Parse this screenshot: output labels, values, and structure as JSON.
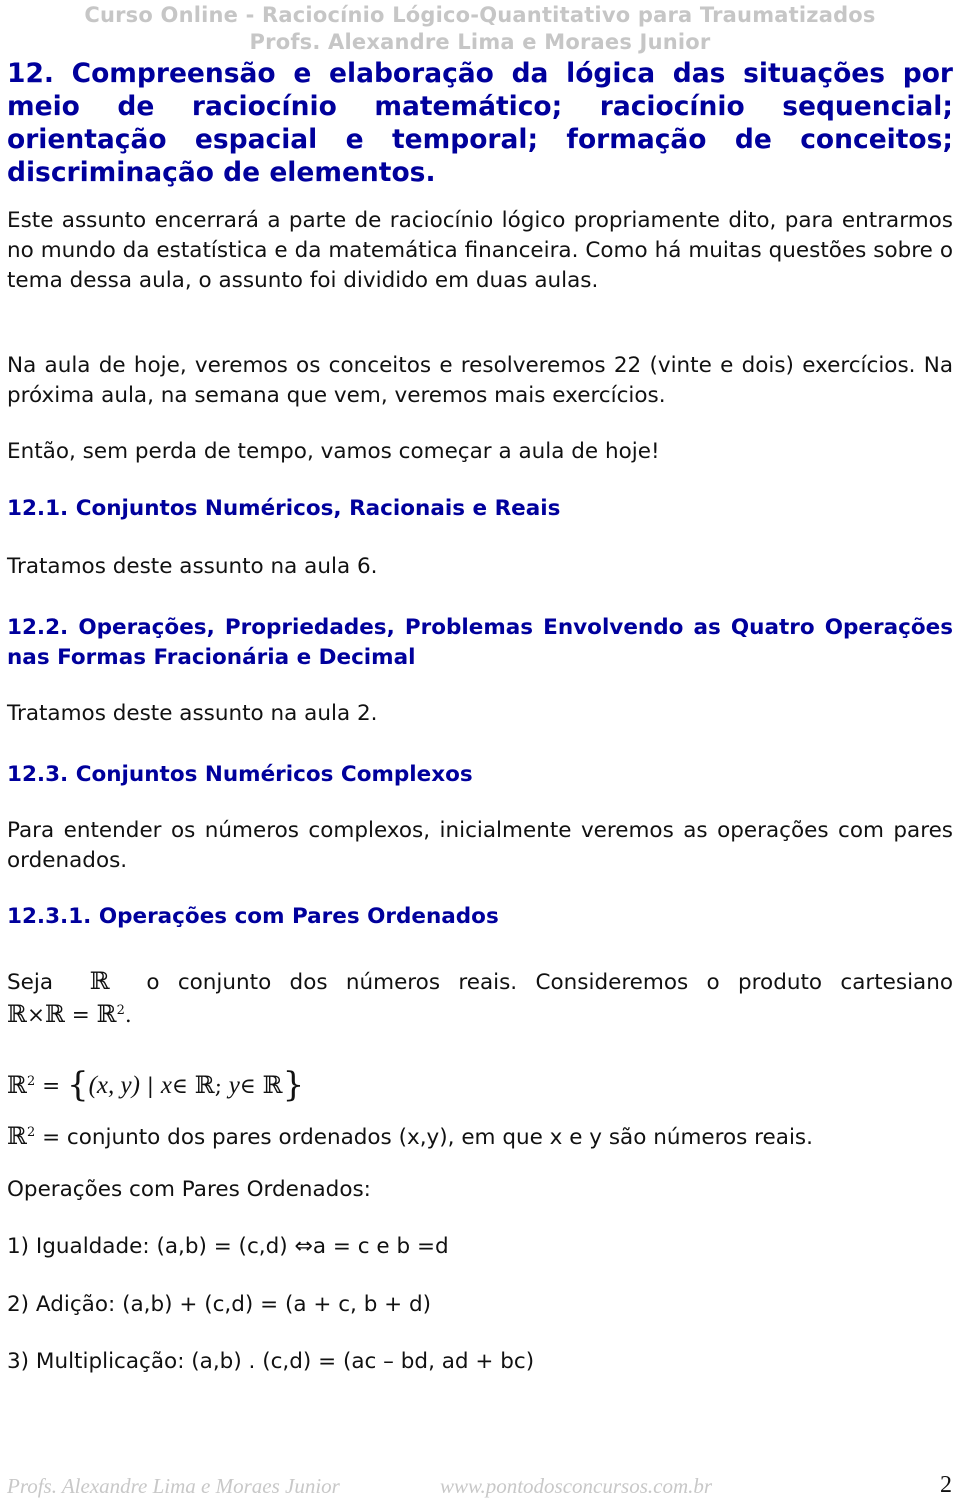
{
  "header": {
    "course_title": "Curso Online - Raciocínio Lógico-Quantitativo para Traumatizados",
    "authors": "Profs. Alexandre Lima e Moraes Junior"
  },
  "section12": {
    "title": "12. Compreensão e elaboração da lógica das situações por meio de raciocínio matemático; raciocínio sequencial; orientação espacial e temporal; formação de conceitos; discriminação de elementos.",
    "para1": "Este assunto encerrará a parte de raciocínio lógico propriamente dito, para entrarmos no mundo da estatística e da matemática financeira. Como há muitas questões sobre o tema dessa aula, o assunto foi dividido em duas aulas.",
    "para2": "Na aula de hoje, veremos os conceitos e resolveremos 22 (vinte e dois) exercícios. Na próxima aula, na semana que vem, veremos mais exercícios.",
    "para3": "Então, sem perda de tempo, vamos começar a aula de hoje!"
  },
  "section12_1": {
    "title": "12.1. Conjuntos Numéricos, Racionais e Reais",
    "text": "Tratamos deste assunto na aula 6."
  },
  "section12_2": {
    "title": "12.2. Operações, Propriedades, Problemas Envolvendo as Quatro Operações nas Formas Fracionária e Decimal",
    "text": "Tratamos deste assunto na aula 2."
  },
  "section12_3": {
    "title": "12.3. Conjuntos Numéricos Complexos",
    "text": "Para entender os números complexos, inicialmente veremos as operações com pares ordenados."
  },
  "section12_3_1": {
    "title": "12.3.1. Operações com Pares Ordenados",
    "seja_prefix": "Seja",
    "seja_suffix": "o conjunto dos números reais. Consideremos o produto cartesiano",
    "reals_symbol": "ℝ",
    "times": "×",
    "equals": "=",
    "squared": "2",
    "period": ".",
    "set_def": {
      "open": "{",
      "pair": "(x, y)",
      "bar": "|",
      "x": "x",
      "in": "∈",
      "semicolon": ";",
      "y": "y",
      "close": "}"
    },
    "r2_desc": "= conjunto dos pares ordenados (x,y), em que x e y são números reais.",
    "ops_heading": "Operações com Pares Ordenados:",
    "ops": [
      {
        "label": "1) Igualdade: (a,b) = (c,d)",
        "iff": "⇔",
        "rest": "a = c e b =d"
      },
      {
        "label": "2) Adição: (a,b) + (c,d) = (a + c, b + d)"
      },
      {
        "label": "3) Multiplicação: (a,b) . (c,d) = (ac – bd, ad + bc)"
      }
    ]
  },
  "footer": {
    "authors": "Profs. Alexandre Lima e Moraes Junior",
    "website": "www.pontodosconcursos.com.br",
    "page_number": "2"
  }
}
